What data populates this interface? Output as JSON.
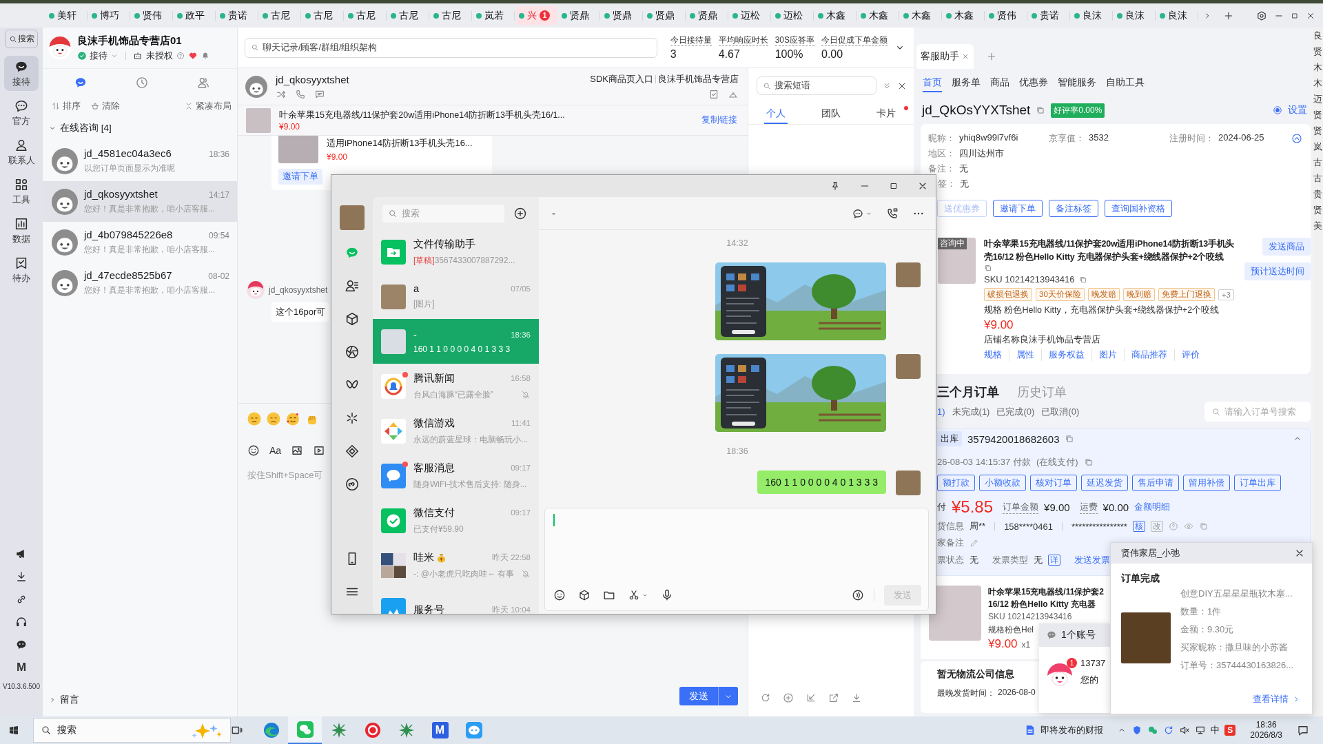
{
  "tabs": [
    {
      "label": "美轩",
      "selected": false
    },
    {
      "label": "博巧",
      "selected": false
    },
    {
      "label": "贤伟",
      "selected": false
    },
    {
      "label": "政平",
      "selected": false
    },
    {
      "label": "贵诺",
      "selected": false
    },
    {
      "label": "古尼",
      "selected": false
    },
    {
      "label": "古尼",
      "selected": false
    },
    {
      "label": "古尼",
      "selected": false
    },
    {
      "label": "古尼",
      "selected": false
    },
    {
      "label": "古尼",
      "selected": false
    },
    {
      "label": "岚若",
      "selected": false
    },
    {
      "label": "兴",
      "selected": true,
      "badge": "1"
    },
    {
      "label": "贤鼎",
      "selected": false
    },
    {
      "label": "贤鼎",
      "selected": false
    },
    {
      "label": "贤鼎",
      "selected": false
    },
    {
      "label": "贤鼎",
      "selected": false
    },
    {
      "label": "迈松",
      "selected": false
    },
    {
      "label": "迈松",
      "selected": false
    },
    {
      "label": "木鑫",
      "selected": false
    },
    {
      "label": "木鑫",
      "selected": false
    },
    {
      "label": "木鑫",
      "selected": false
    },
    {
      "label": "木鑫",
      "selected": false
    },
    {
      "label": "贤伟",
      "selected": false
    },
    {
      "label": "贵诺",
      "selected": false
    },
    {
      "label": "良沫",
      "selected": false
    },
    {
      "label": "良沫",
      "selected": false
    },
    {
      "label": "良沫",
      "selected": false
    }
  ],
  "sidebar": {
    "search": "搜索",
    "items": [
      {
        "label": "接待",
        "selected": true
      },
      {
        "label": "官方",
        "selected": false
      },
      {
        "label": "联系人",
        "selected": false
      },
      {
        "label": "工具",
        "selected": false
      },
      {
        "label": "数据",
        "selected": false
      },
      {
        "label": "待办",
        "selected": false
      }
    ],
    "logo": "M",
    "version": "V10.3.6.500"
  },
  "store": {
    "name": "良沫手机饰品专营店01",
    "status": "接待",
    "auth": "未授权"
  },
  "list_tabs": [
    {
      "selected": true
    },
    {
      "selected": false
    },
    {
      "selected": false
    }
  ],
  "list_actions": [
    "排序",
    "清除",
    "紧凑布局"
  ],
  "online_group": {
    "title": "在线咨询 [4]",
    "expanded": true
  },
  "conversations": [
    {
      "name": "jd_4581ec04a3ec6",
      "time": "18:36",
      "preview": "以您订单页面显示为准呢",
      "selected": false
    },
    {
      "name": "jd_qkosyyxtshet",
      "time": "14:17",
      "preview": "您好！真是非常抱歉，咱小店客服...",
      "selected": true
    },
    {
      "name": "jd_4b079845226e8",
      "time": "09:54",
      "preview": "您好！真是非常抱歉，咱小店客服...",
      "selected": false
    },
    {
      "name": "jd_47ecde8525b67",
      "time": "08-02",
      "preview": "您好！真是非常抱歉，咱小店客服...",
      "selected": false
    }
  ],
  "message_group": {
    "title": "留言",
    "expanded": false
  },
  "stats": {
    "search_placeholder": "聊天记录/顾客/群组/组织架构",
    "items": [
      {
        "label": "今日接待量",
        "value": "3"
      },
      {
        "label": "平均响应时长",
        "value": "4.67"
      },
      {
        "label": "30S应答率",
        "value": "100%"
      },
      {
        "label": "今日促成下单金额",
        "value": "0.00"
      }
    ]
  },
  "chat": {
    "customer": "jd_qkosyyxtshet",
    "source": "SDK商品页入口",
    "shop": "良沫手机饰品专营店",
    "product": {
      "title": "叶余苹果15充电器线/11保护套20w适用iPhone14防折断13手机头壳16/1...",
      "price": "¥9.00",
      "link": "复制链接"
    },
    "card": {
      "title": "适用iPhone14防折断13手机头壳16...",
      "price": "¥9.00",
      "button": "邀请下单"
    },
    "message": {
      "sender": "jd_qkosyyxtshet",
      "text": "这个16por可"
    },
    "toolbar_text": "Aa",
    "input_placeholder": "按住Shift+Space可",
    "send": "发送"
  },
  "quick_replies": {
    "search_placeholder": "搜索短语",
    "tabs": [
      {
        "label": "个人",
        "selected": true,
        "dot": false
      },
      {
        "label": "团队",
        "selected": false,
        "dot": false
      },
      {
        "label": "卡片",
        "selected": false,
        "dot": true
      }
    ]
  },
  "assistant": {
    "tab": "客服助手",
    "nav": [
      {
        "label": "首页",
        "selected": true
      },
      {
        "label": "服务单",
        "selected": false
      },
      {
        "label": "商品",
        "selected": false
      },
      {
        "label": "优惠券",
        "selected": false
      },
      {
        "label": "智能服务",
        "selected": false
      },
      {
        "label": "自助工具",
        "selected": false
      }
    ],
    "customer_id": "jd_QkOsYYXTshet",
    "rating": "好评率0.00%",
    "settings": {
      "label": "设置",
      "on": true
    },
    "profile": [
      {
        "label": "昵称：",
        "value": "yhiq8w99l7vf6i"
      },
      {
        "label": "京享值：",
        "value": "3532"
      },
      {
        "label": "注册时间：",
        "value": "2024-06-25"
      },
      {
        "label": "地区：",
        "value": "四川达州市"
      },
      {
        "label": "备注：",
        "value": "无"
      },
      {
        "label": "签：",
        "value": "无"
      }
    ],
    "actions": [
      {
        "label": "送优惠券",
        "disabled": true
      },
      {
        "label": "邀请下单",
        "disabled": false
      },
      {
        "label": "备注标签",
        "disabled": false
      },
      {
        "label": "查询国补资格",
        "disabled": false
      }
    ],
    "product": {
      "status": "咨询中",
      "title": "叶余苹果15充电器线/11保护套20w适用iPhone14防折断13手机头壳16/12 粉色Hello Kitty 充电器保护头套+绕线器保护+2个咬线",
      "sku": "SKU 10214213943416",
      "tags": [
        "破损包退换",
        "30天价保险",
        "晚发赔",
        "晚到赔",
        "免费上门退换"
      ],
      "more_tags": "+3",
      "spec": "规格 粉色Hello Kitty，充电器保护头套+绕线器保护+2个咬线",
      "price": "¥9.00",
      "shop": "店铺名称良沫手机饰品专营店",
      "links": [
        "规格",
        "属性",
        "服务权益",
        "图片",
        "商品推荐",
        "评价"
      ],
      "buttons": [
        "发送商品",
        "预计送达时间"
      ]
    },
    "orders": {
      "tabs": [
        {
          "label": "三个月订单",
          "selected": true
        },
        {
          "label": "历史订单",
          "selected": false
        }
      ],
      "filters": [
        {
          "label": "1)",
          "selected": true
        },
        {
          "label": "未完成(1)",
          "selected": false
        },
        {
          "label": "已完成(0)",
          "selected": false
        },
        {
          "label": "已取消(0)",
          "selected": false
        }
      ],
      "search_placeholder": "请输入订单号搜索",
      "order": {
        "status": "出库",
        "id": "3579420018682603",
        "time": "26-08-03 14:15:37 付款",
        "payment": "(在线支付)",
        "expanded": true,
        "actions": [
          "额打款",
          "小额收款",
          "核对订单",
          "延迟发货",
          "售后申请",
          "留用补偿",
          "订单出库"
        ],
        "paid_label": "付",
        "paid": "¥5.85",
        "amount_label": "订单金额",
        "amount": "¥9.00",
        "freight_label": "运费",
        "freight": "¥0.00",
        "detail": "金额明细",
        "receiver_label": "货信息",
        "receiver": "周**",
        "phone": "158****0461",
        "address": "****************",
        "verify": "核",
        "edit": "改",
        "note_label": "家备注",
        "invoice_label": "票状态",
        "invoice": "无",
        "invoice_type_label": "发票类型",
        "invoice_type": "无",
        "invoice_detail": "详",
        "send_invoice": "发送发票",
        "item": {
          "title": [
            "叶余苹果15充电器线/11保护套2",
            "16/12 粉色Hello Kitty 充电器"
          ],
          "sku": "SKU 10214213943416",
          "spec": "规格粉色Hel",
          "price": "¥9.00",
          "qty": "x1"
        }
      }
    },
    "logistics": {
      "title": "暂无物流公司信息",
      "deadline_label": "最晚发货时间：",
      "deadline": "2026-08-0"
    }
  },
  "wechat": {
    "search_placeholder": "搜索",
    "rail": [
      {
        "selected": true
      },
      {
        "selected": false
      },
      {
        "selected": false
      },
      {
        "selected": false
      },
      {
        "selected": false
      },
      {
        "selected": false
      },
      {
        "selected": false
      },
      {
        "selected": false
      }
    ],
    "chats": [
      {
        "name": "文件传输助手",
        "draft": "[草稿]",
        "preview": "3567433007887292...",
        "selected": false,
        "unread": false,
        "muted": false
      },
      {
        "name": "a",
        "time": "07/05",
        "preview": "[图片]",
        "selected": false,
        "unread": false,
        "muted": false
      },
      {
        "name": "-",
        "time": "18:36",
        "preview": "160 1 1 0 0 0 0 4 0 1 3 3 3",
        "selected": true,
        "unread": false,
        "muted": false
      },
      {
        "name": "腾讯新闻",
        "time": "16:58",
        "preview": "台风白海豚“已露全脸”",
        "selected": false,
        "unread": true,
        "muted": true
      },
      {
        "name": "微信游戏",
        "time": "11:41",
        "preview": "永远的蔚蓝星球：电脑畅玩小...",
        "selected": false,
        "unread": false,
        "muted": false
      },
      {
        "name": "客服消息",
        "time": "09:17",
        "preview": "随身WiFi-技术售后支持: 随身...",
        "selected": false,
        "unread": true,
        "muted": false
      },
      {
        "name": "微信支付",
        "time": "09:17",
        "preview": "已支付¥59.90",
        "selected": false,
        "unread": false,
        "muted": false
      },
      {
        "name": "哇米",
        "time": "昨天 22:58",
        "preview": "-: @小老虎只吃肉哇～ 有事",
        "selected": false,
        "unread": false,
        "muted": true
      },
      {
        "name": "服务号",
        "time": "昨天 10:04",
        "selected": false,
        "unread": false,
        "muted": false
      }
    ],
    "active_chat": {
      "title": "-",
      "messages": [
        {
          "kind": "time",
          "text": "14:32"
        },
        {
          "kind": "image"
        },
        {
          "kind": "image"
        },
        {
          "kind": "time",
          "text": "18:36"
        },
        {
          "kind": "text",
          "text": "160 1 1 0 0 0 0 4 0 1 3 3 3"
        }
      ]
    },
    "send": {
      "label": "发送",
      "disabled": true
    }
  },
  "account_popup": {
    "label": "1个账号",
    "badge": "1",
    "phone": "13737",
    "text": "您的"
  },
  "notification": {
    "sender": "贤伟家居_小弛",
    "title": "订单完成",
    "product": "创意DIY五星星星瓶软木塞...",
    "lines": [
      "数量：1件",
      "金额：9.30元",
      "买家昵称：撒旦味的小苏酱",
      "订单号：35744430163826..."
    ],
    "link": "查看详情"
  },
  "taskbar": {
    "search_placeholder": "搜索",
    "apps": [
      {
        "active": false
      },
      {
        "active": true
      },
      {
        "active": false
      },
      {
        "active": false
      },
      {
        "active": false
      },
      {
        "active": false,
        "label": "M"
      },
      {
        "active": false
      }
    ],
    "news": "即将发布的财报",
    "ime": "中",
    "tray_logo": "S",
    "time": "18:36",
    "date": "2026/8/3"
  },
  "edge_strip": [
    "良",
    "贤",
    "木",
    "木",
    "迈",
    "贤",
    "贤",
    "岚",
    "古",
    "古",
    "贵",
    "贤",
    "美"
  ]
}
